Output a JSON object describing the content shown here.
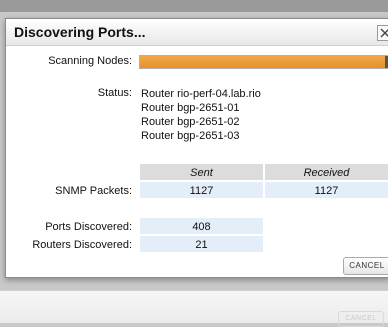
{
  "dialog": {
    "title": "Discovering Ports...",
    "scanning_label": "Scanning Nodes:",
    "progress_fraction": 0.98,
    "status_label": "Status:",
    "status_lines": [
      "Router rio-perf-04.lab.rio",
      "Router bgp-2651-01",
      "Router bgp-2651-02",
      "Router bgp-2651-03"
    ],
    "table": {
      "col_sent": "Sent",
      "col_received": "Received",
      "snmp_label": "SNMP Packets:",
      "snmp_sent": "1127",
      "snmp_received": "1127",
      "ports_label": "Ports Discovered:",
      "ports_value": "408",
      "routers_label": "Routers Discovered:",
      "routers_value": "21"
    },
    "cancel_label": "CANCEL"
  },
  "background_dialog": {
    "cancel_label": "CANCEL"
  },
  "colors": {
    "progress": "#e8902a",
    "value_cell": "#e4eef8",
    "header_cell": "#dcdcdc"
  }
}
